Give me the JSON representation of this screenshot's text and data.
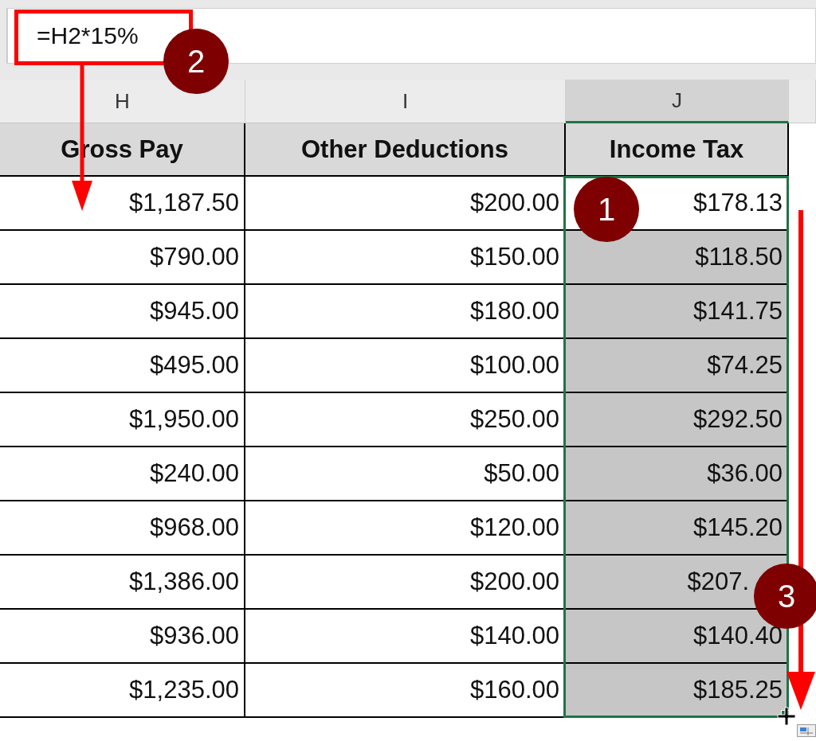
{
  "formula_bar": {
    "value": "=H2*15%"
  },
  "column_headers": [
    {
      "label": "H",
      "selected": false
    },
    {
      "label": "I",
      "selected": false
    },
    {
      "label": "J",
      "selected": true
    }
  ],
  "table": {
    "columns": [
      "Gross Pay",
      "Other Deductions",
      "Income Tax"
    ],
    "rows": [
      {
        "cells": [
          "$1,187.50",
          "$200.00",
          "$178.13"
        ],
        "active": true
      },
      {
        "cells": [
          "$790.00",
          "$150.00",
          "$118.50"
        ],
        "active": false
      },
      {
        "cells": [
          "$945.00",
          "$180.00",
          "$141.75"
        ],
        "active": false
      },
      {
        "cells": [
          "$495.00",
          "$100.00",
          "$74.25"
        ],
        "active": false
      },
      {
        "cells": [
          "$1,950.00",
          "$250.00",
          "$292.50"
        ],
        "active": false
      },
      {
        "cells": [
          "$240.00",
          "$50.00",
          "$36.00"
        ],
        "active": false
      },
      {
        "cells": [
          "$968.00",
          "$120.00",
          "$145.20"
        ],
        "active": false
      },
      {
        "cells": [
          "$1,386.00",
          "$200.00",
          "$207."
        ],
        "active": false
      },
      {
        "cells": [
          "$936.00",
          "$140.00",
          "$140.40"
        ],
        "active": false
      },
      {
        "cells": [
          "$1,235.00",
          "$160.00",
          "$185.25"
        ],
        "active": false
      }
    ]
  },
  "annotations": [
    {
      "kind": "step",
      "label": "1"
    },
    {
      "kind": "step",
      "label": "2"
    },
    {
      "kind": "step",
      "label": "3"
    }
  ]
}
